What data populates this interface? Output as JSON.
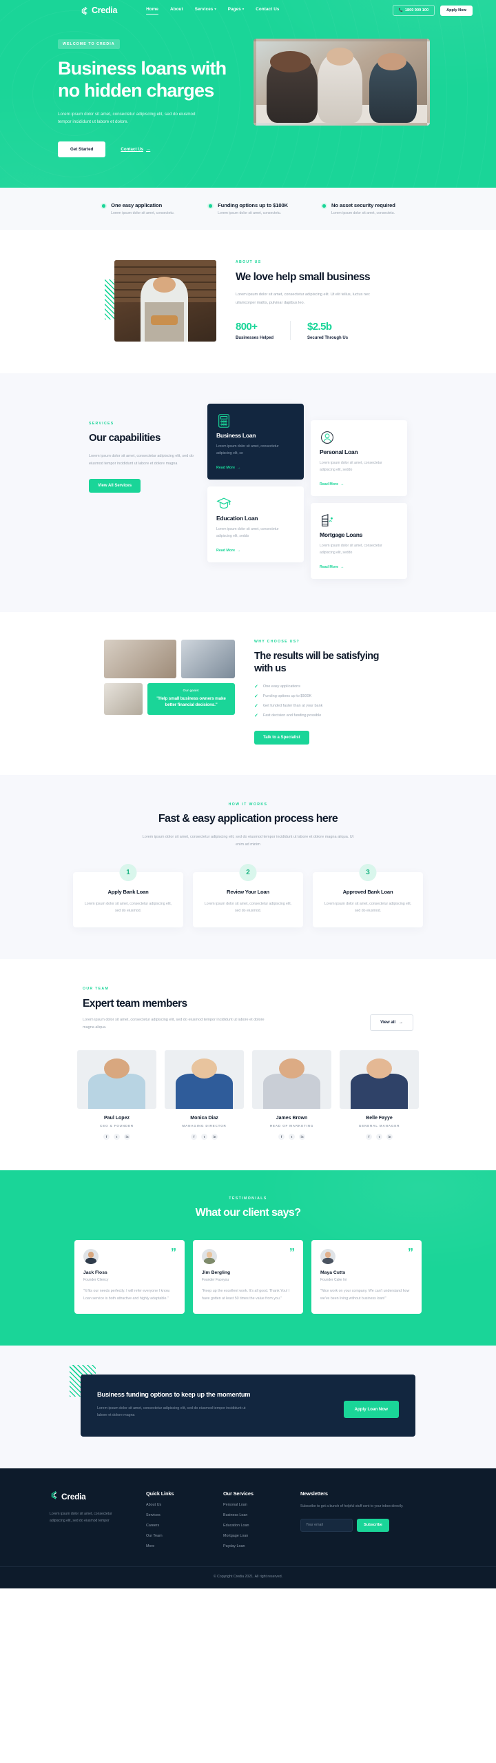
{
  "brand": {
    "name": "Credia",
    "logo_icon": "credia-c-logo"
  },
  "nav": {
    "links": [
      {
        "label": "Home",
        "has_caret": false,
        "active": true
      },
      {
        "label": "About",
        "has_caret": false,
        "active": false
      },
      {
        "label": "Services",
        "has_caret": true,
        "active": false
      },
      {
        "label": "Pages",
        "has_caret": true,
        "active": false
      },
      {
        "label": "Contact Us",
        "has_caret": false,
        "active": false
      }
    ],
    "phone": "1800 909 100",
    "phone_icon": "phone-icon",
    "apply_label": "Apply Now"
  },
  "hero": {
    "badge": "WELCOME TO CREDIA",
    "title": "Business loans with no hidden charges",
    "subtitle": "Lorem ipsum dolor sit amet, consectetur adipiscing elit, sed do eiusmod tempor incididunt ut labore et dolore.",
    "primary_cta": "Get Started",
    "secondary_cta": "Contact Us",
    "arrow_icon": "arrow-right-icon"
  },
  "features": [
    {
      "title": "One easy application",
      "desc": "Lorem ipsum dolor sit amet, consectetu.",
      "icon": "check-circle-icon"
    },
    {
      "title": "Funding options up to $100K",
      "desc": "Lorem ipsum dolor sit amet, consectetu.",
      "icon": "check-circle-icon"
    },
    {
      "title": "No asset security required",
      "desc": "Lorem ipsum dolor sit amet, consectetu.",
      "icon": "check-circle-icon"
    }
  ],
  "about": {
    "eyebrow": "ABOUT US",
    "title": "We love help small business",
    "desc": "Lorem ipsum dolor sit amet, consectetur adipiscing elit. Ut elit tellus, luctus nec ullamcorper mattis, pulvinar dapibus leo.",
    "stats": [
      {
        "number": "800+",
        "label": "Businesses Helped"
      },
      {
        "number": "$2.5b",
        "label": "Secured Through Us"
      }
    ]
  },
  "services": {
    "eyebrow": "SERVICES",
    "title": "Our capabilities",
    "desc": "Lorem ipsum dolor sit amet, consectetur adipiscing elit, sed do eiusmod tempor incididunt ut labore et dolore magna",
    "button": "View All Services",
    "read_more": "Read More",
    "cards": [
      {
        "title": "Business Loan",
        "desc": "Lorem ipsum dolor sit amet, consectetur adipiscing elit, se",
        "icon": "calculator-icon",
        "dark": true
      },
      {
        "title": "Education Loan",
        "desc": "Lorem ipsum dolor sit amet, consectetur adipiscing elit, seddo",
        "icon": "graduation-cap-icon",
        "dark": false
      },
      {
        "title": "Personal Loan",
        "desc": "Lorem ipsum dolor sit amet, consectetur adipiscing elit, seddo",
        "icon": "person-circle-icon",
        "dark": false
      },
      {
        "title": "Mortgage Loans",
        "desc": "Lorem ipsum dolor sit amet, consectetur adipiscing elit, seddo",
        "icon": "building-icon",
        "dark": false
      }
    ]
  },
  "why": {
    "eyebrow": "WHY CHOOSE US?",
    "title": "The results will be satisfying with us",
    "items": [
      "One easy applications",
      "Funding options up to $500K",
      "Get funded faster than at your bank",
      "Fast decision and funding possible"
    ],
    "button": "Talk to a Specialist",
    "goal_label": "Our goals:",
    "goal_quote": "\"Help small business owners make better financial decisions.\""
  },
  "how": {
    "eyebrow": "HOW IT WORKS",
    "title": "Fast & easy application process here",
    "desc": "Lorem ipsum dolor sit amet, consectetur adipiscing elit, sed do eiusmod tempor incididunt ut labore et dolore magna aliqua. Ut enim ad minim",
    "steps": [
      {
        "num": "1",
        "title": "Apply Bank Loan",
        "desc": "Lorem ipsum dolor sit amet, consectetur adipiscing elit, sed do eiusmod."
      },
      {
        "num": "2",
        "title": "Review Your Loan",
        "desc": "Lorem ipsum dolor sit amet, consectetur adipiscing elit, sed do eiusmod."
      },
      {
        "num": "3",
        "title": "Approved Bank Loan",
        "desc": "Lorem ipsum dolor sit amet, consectetur adipiscing elit, sed do eiusmod."
      }
    ]
  },
  "team": {
    "eyebrow": "OUR TEAM",
    "title": "Expert team members",
    "desc": "Lorem ipsum dolor sit amet, consectetur adipiscing elit, sed do eiusmod tempor incididunt ut labore et dolore magna aliqua.",
    "view_all": "View all",
    "socials": [
      "f",
      "t",
      "in"
    ],
    "members": [
      {
        "name": "Paul Lopez",
        "role": "CEO & FOUNDER",
        "shirt": "#b8d4e3",
        "skin": "#d8a77f"
      },
      {
        "name": "Monica Diaz",
        "role": "MANAGING DIRECTOR",
        "shirt": "#2f5c9a",
        "skin": "#e8c49e"
      },
      {
        "name": "James Brown",
        "role": "HEAD OF MARKETING",
        "shirt": "#c9ced6",
        "skin": "#dcab84"
      },
      {
        "name": "Belle Fayye",
        "role": "GENERAL MANAGER",
        "shirt": "#2f4268",
        "skin": "#e4b894"
      }
    ]
  },
  "testimonials": {
    "eyebrow": "TESTIMONIALS",
    "title": "What our client says?",
    "quote_icon": "quote-mark-icon",
    "items": [
      {
        "name": "Jack Floss",
        "role": "Founder Cliency",
        "text": "\"It fits our needs perfectly. I will refer everyone I know. Loan service is both attractive and highly adaptable.\"",
        "skin": "#d8a77f",
        "shirt": "#2e3b4a"
      },
      {
        "name": "Jim Bergling",
        "role": "Founder Faceyou",
        "text": "\"Keep up the excellent work. It's all good. Thank You! I have gotten at least 50 times the value from you.\"",
        "skin": "#e8c49e",
        "shirt": "#7e8a6a"
      },
      {
        "name": "Maya Cutts",
        "role": "Founder Cake Ini",
        "text": "\"Nice work on your company. We can't understand how we've been living without business loan!\"",
        "skin": "#e0b08c",
        "shirt": "#4a5360"
      }
    ]
  },
  "cta": {
    "title": "Business funding options to keep up the momentum",
    "desc": "Lorem ipsum dolor sit amet, consectetur adipiscing elit, sed do eiusmod tempor incididunt ut labore et dolore magna",
    "button": "Apply Loan Now"
  },
  "footer": {
    "desc": "Lorem ipsum dolor sit amet, consectetur adipiscing elit, sed do eiusmod tempor",
    "quick_links": {
      "heading": "Quick Links",
      "items": [
        "About Us",
        "Services",
        "Careers",
        "Our Team",
        "More"
      ]
    },
    "our_services": {
      "heading": "Our Services",
      "items": [
        "Personal Loan",
        "Business Loan",
        "Education Loan",
        "Mortgage Loan",
        "Payday Loan"
      ]
    },
    "newsletter": {
      "heading": "Newsletters",
      "desc": "Subscribe to get a bunch of helpful stuff sent to your inbox directly.",
      "placeholder": "Your email",
      "value": "",
      "button": "Subscribe"
    },
    "copyright": "© Copyright Credia 2021. All right reserved."
  },
  "colors": {
    "accent": "#1ad598",
    "dark": "#12263f",
    "footer": "#0d1b2b",
    "light": "#f7f8fc"
  }
}
